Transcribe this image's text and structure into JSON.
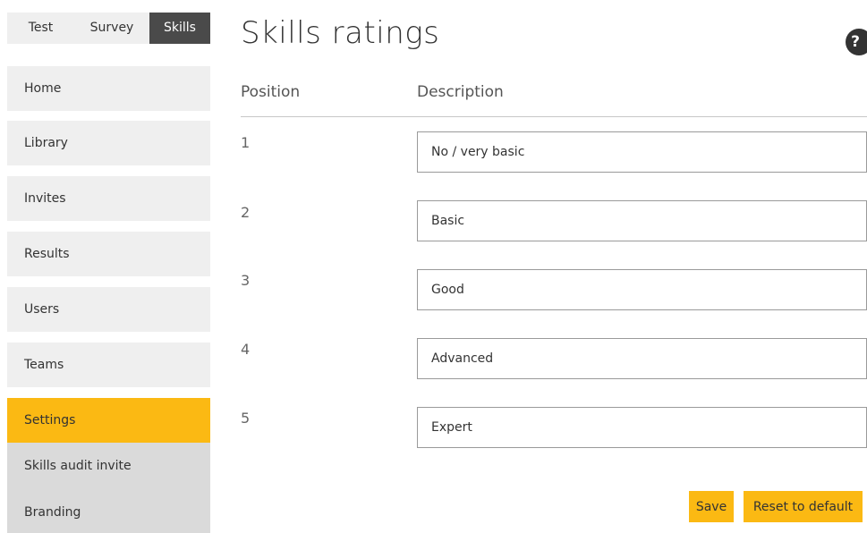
{
  "mode_tabs": [
    {
      "label": "Test"
    },
    {
      "label": "Survey"
    },
    {
      "label": "Skills"
    }
  ],
  "sidebar": {
    "items": [
      {
        "label": "Home"
      },
      {
        "label": "Library"
      },
      {
        "label": "Invites"
      },
      {
        "label": "Results"
      },
      {
        "label": "Users"
      },
      {
        "label": "Teams"
      },
      {
        "label": "Settings"
      }
    ],
    "sub_items": [
      {
        "label": "Skills audit invite"
      },
      {
        "label": "Branding"
      }
    ]
  },
  "page": {
    "title": "Skills ratings",
    "help_glyph": "?"
  },
  "table": {
    "headers": {
      "position": "Position",
      "description": "Description"
    },
    "rows": [
      {
        "position": "1",
        "description": "No / very basic"
      },
      {
        "position": "2",
        "description": "Basic"
      },
      {
        "position": "3",
        "description": "Good"
      },
      {
        "position": "4",
        "description": "Advanced"
      },
      {
        "position": "5",
        "description": "Expert"
      }
    ]
  },
  "actions": {
    "save_label": "Save",
    "reset_label": "Reset to default"
  },
  "colors": {
    "accent": "#fbb913",
    "active_tab": "#4a4a4a",
    "nav_bg": "#efefef",
    "subnav_bg": "#dadada"
  },
  "icons": {
    "help": "help-icon"
  }
}
